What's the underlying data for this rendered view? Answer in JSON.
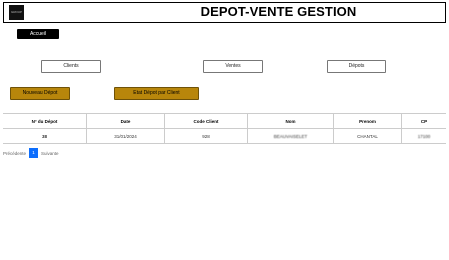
{
  "header": {
    "logo_text": "GROUP",
    "title": "DEPOT-VENTE GESTION"
  },
  "home_button": "Accueil",
  "nav": {
    "clients": "Clients",
    "ventes": "Ventes",
    "depots": "Dépots"
  },
  "actions": {
    "new_depot": "Nouveau Dépot",
    "etat_depot": "Etat Dépot par Client"
  },
  "table": {
    "columns": [
      "N° du Dépot",
      "Date",
      "Code Client",
      "Nom",
      "Prenom",
      "CP"
    ],
    "rows": [
      {
        "depot": "38",
        "date": "31/01/2024",
        "code_client": "928",
        "nom": "BEAUVAISELET",
        "prenom": "CHANTAL",
        "cp": "17100"
      }
    ]
  },
  "pagination": {
    "previous": "Précédente",
    "current": "1",
    "next": "Suivante"
  }
}
